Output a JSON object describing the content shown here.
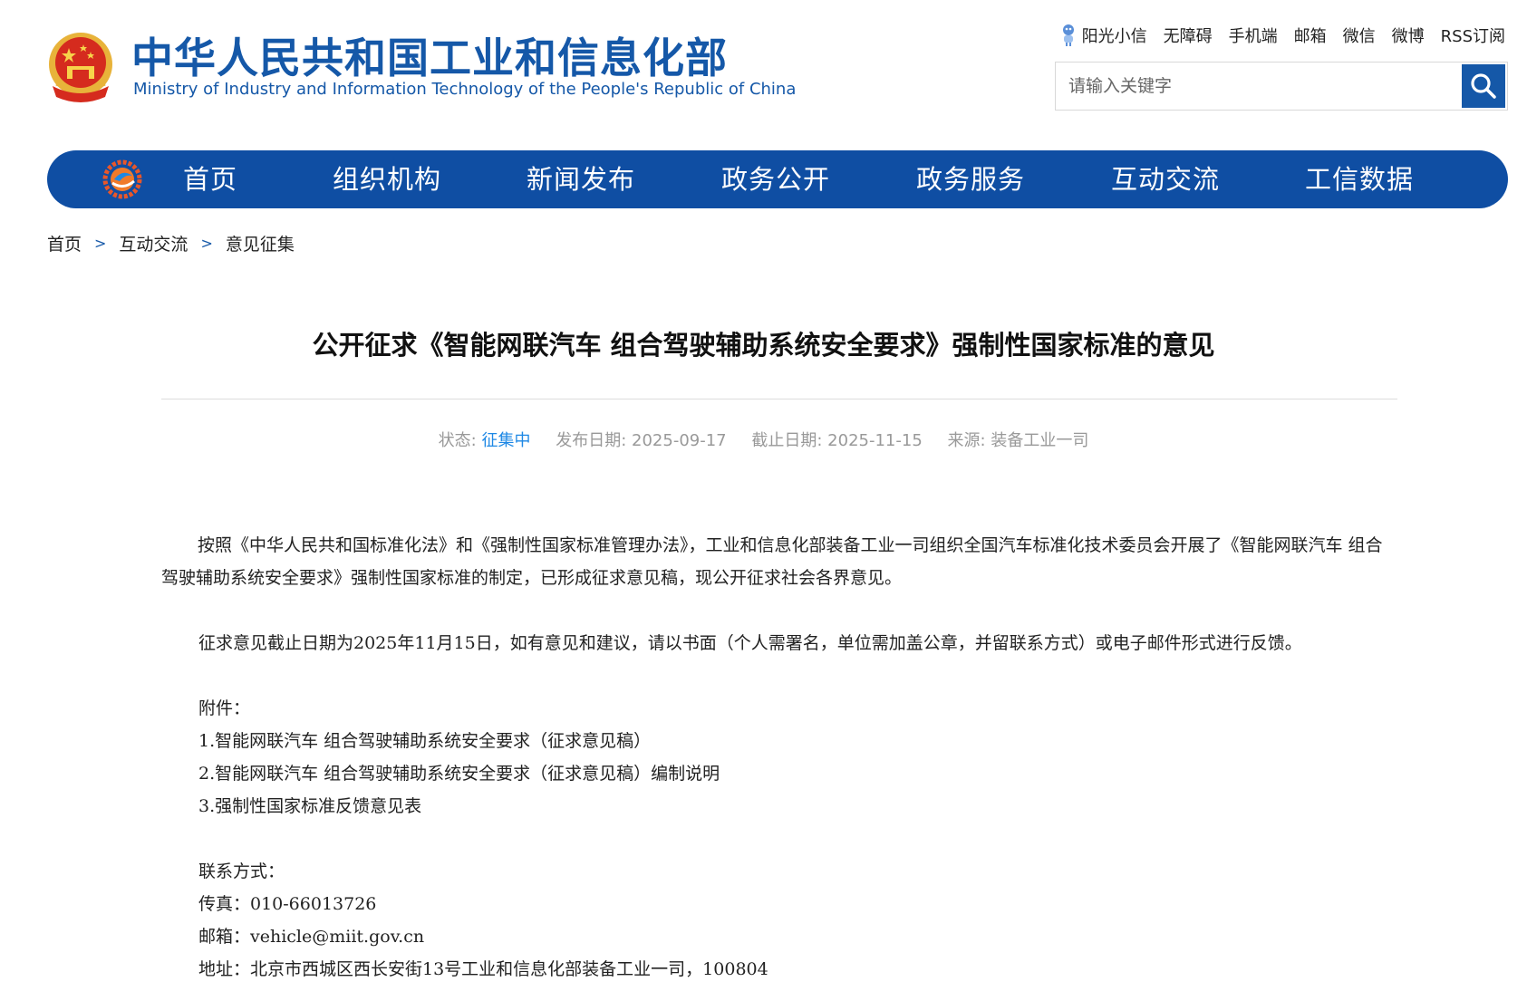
{
  "header": {
    "title": "中华人民共和国工业和信息化部",
    "subtitle": "Ministry of Industry and Information Technology of the People's Republic of China"
  },
  "top_links": [
    "阳光小信",
    "无障碍",
    "手机端",
    "邮箱",
    "微信",
    "微博",
    "RSS订阅"
  ],
  "search": {
    "placeholder": "请输入关键字"
  },
  "nav": [
    "首页",
    "组织机构",
    "新闻发布",
    "政务公开",
    "政务服务",
    "互动交流",
    "工信数据"
  ],
  "breadcrumb": [
    "首页",
    "互动交流",
    "意见征集"
  ],
  "breadcrumb_sep": ">",
  "article": {
    "title": "公开征求《智能网联汽车 组合驾驶辅助系统安全要求》强制性国家标准的意见",
    "meta": {
      "status_label": "状态:",
      "status_value": "征集中",
      "publish_label": "发布日期:",
      "publish_date": "2025-09-17",
      "deadline_label": "截止日期:",
      "deadline_date": "2025-11-15",
      "source_label": "来源:",
      "source_value": "装备工业一司"
    },
    "paragraph1": "按照《中华人民共和国标准化法》和《强制性国家标准管理办法》，工业和信息化部装备工业一司组织全国汽车标准化技术委员会开展了《智能网联汽车 组合驾驶辅助系统安全要求》强制性国家标准的制定，已形成征求意见稿，现公开征求社会各界意见。",
    "paragraph2": "征求意见截止日期为2025年11月15日，如有意见和建议，请以书面（个人需署名，单位需加盖公章，并留联系方式）或电子邮件形式进行反馈。",
    "attachments_label": "附件：",
    "attachments": [
      "1.智能网联汽车 组合驾驶辅助系统安全要求（征求意见稿）",
      "2.智能网联汽车 组合驾驶辅助系统安全要求（征求意见稿）编制说明",
      "3.强制性国家标准反馈意见表"
    ],
    "contact_label": "联系方式：",
    "contact": {
      "fax": "传真：010-66013726",
      "email": "邮箱：vehicle@miit.gov.cn",
      "address": "地址：北京市西城区西长安街13号工业和信息化部装备工业一司，100804"
    }
  },
  "colors": {
    "brand_blue": "#1558a8",
    "nav_blue": "#0f4ea3",
    "status_blue": "#1e88e5"
  },
  "icons": [
    "national-emblem",
    "robot-mascot-icon",
    "search-icon",
    "miit-logo-icon"
  ]
}
